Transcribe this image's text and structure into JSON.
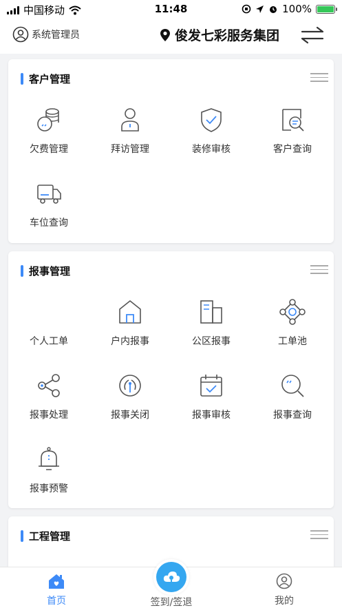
{
  "status": {
    "carrier": "中国移动",
    "time": "11:48",
    "battery": "100%"
  },
  "header": {
    "user": "系统管理员",
    "org": "俊发七彩服务集团"
  },
  "cards": [
    {
      "title": "客户管理",
      "items": [
        {
          "label": "欠费管理",
          "icon": "coins-icon"
        },
        {
          "label": "拜访管理",
          "icon": "person-icon"
        },
        {
          "label": "装修审核",
          "icon": "shield-check-icon"
        },
        {
          "label": "客户查询",
          "icon": "document-search-icon"
        },
        {
          "label": "车位查询",
          "icon": "truck-icon"
        }
      ]
    },
    {
      "title": "报事管理",
      "items": [
        {
          "label": "个人工单",
          "icon": "personal-order-icon"
        },
        {
          "label": "户内报事",
          "icon": "house-icon"
        },
        {
          "label": "公区报事",
          "icon": "buildings-icon"
        },
        {
          "label": "工单池",
          "icon": "network-icon"
        },
        {
          "label": "报事处理",
          "icon": "share-icon"
        },
        {
          "label": "报事关闭",
          "icon": "power-icon"
        },
        {
          "label": "报事审核",
          "icon": "calendar-check-icon"
        },
        {
          "label": "报事查询",
          "icon": "search-icon"
        },
        {
          "label": "报事预警",
          "icon": "bell-icon"
        }
      ]
    },
    {
      "title": "工程管理",
      "items": []
    }
  ],
  "tabs": {
    "home": "首页",
    "checkin": "签到/签退",
    "mine": "我的"
  },
  "colors": {
    "accent": "#3d8af7",
    "checkin": "#35a7f0",
    "icon_stroke": "#555555",
    "icon_accent": "#3d8af7"
  }
}
